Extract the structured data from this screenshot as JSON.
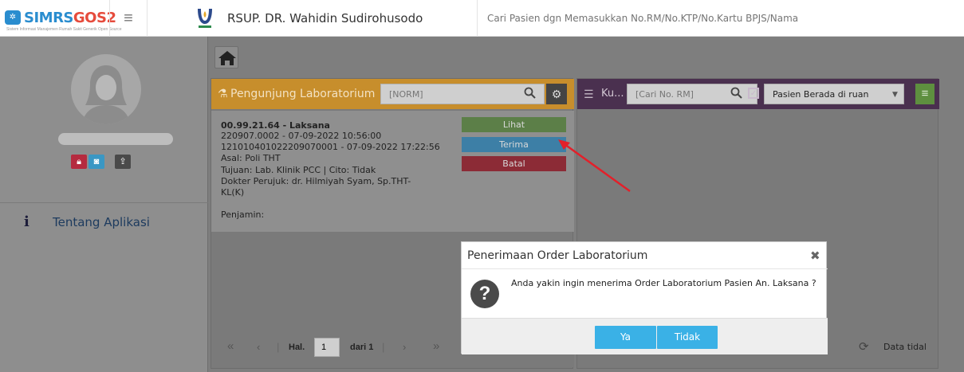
{
  "app": {
    "logo_text": "SIMRS",
    "logo_text2": "GOS2",
    "logo_subtitle": "Sistem Informasi Manajemen Rumah Sakit Generik Open Source",
    "hospital_name": "RSUP. DR. Wahidin Sudirohusodo",
    "search_placeholder": "Cari Pasien dgn Memasukkan No.RM/No.KTP/No.Kartu BPJS/Nama"
  },
  "sidebar": {
    "about_label": "Tentang Aplikasi"
  },
  "lab_panel": {
    "title": "Pengunjung Laboratorium",
    "search_placeholder": "[NORM]",
    "patient": {
      "id_name": "00.99.21.64 - Laksana",
      "registration": "220907.0002 - 07-09-2022 10:56:00",
      "order": "121010401022209070001 - 07-09-2022 17:22:56",
      "asal": "Asal: Poli THT",
      "tujuan": "Tujuan: Lab. Klinik PCC | Cito: Tidak",
      "dokter": "Dokter Perujuk: dr. Hilmiyah Syam, Sp.THT-KL(K)",
      "penjamin": "Penjamin:"
    },
    "buttons": {
      "lihat": "Lihat",
      "terima": "Terima",
      "batal": "Batal"
    },
    "pager": {
      "first": "«",
      "prev": "‹",
      "sep": "|",
      "hal_label": "Hal.",
      "page_value": "1",
      "dari_label": "dari 1",
      "next": "›",
      "last": "»"
    }
  },
  "kunjungan_panel": {
    "title": "Ku...",
    "search_placeholder": "[Cari No. RM]",
    "ruang_select": "Pasien Berada di ruan",
    "nodata_text": "Data tidal"
  },
  "modal": {
    "title": "Penerimaan Order Laboratorium",
    "message": "Anda yakin ingin menerima Order Laboratorium Pasien An. Laksana ?",
    "yes_label": "Ya",
    "no_label": "Tidak"
  },
  "colors": {
    "lab_header": "#c78e2c",
    "kunjungan_header": "#4a304f",
    "modal_button": "#3ab1e6",
    "arrow": "#e3202a"
  }
}
